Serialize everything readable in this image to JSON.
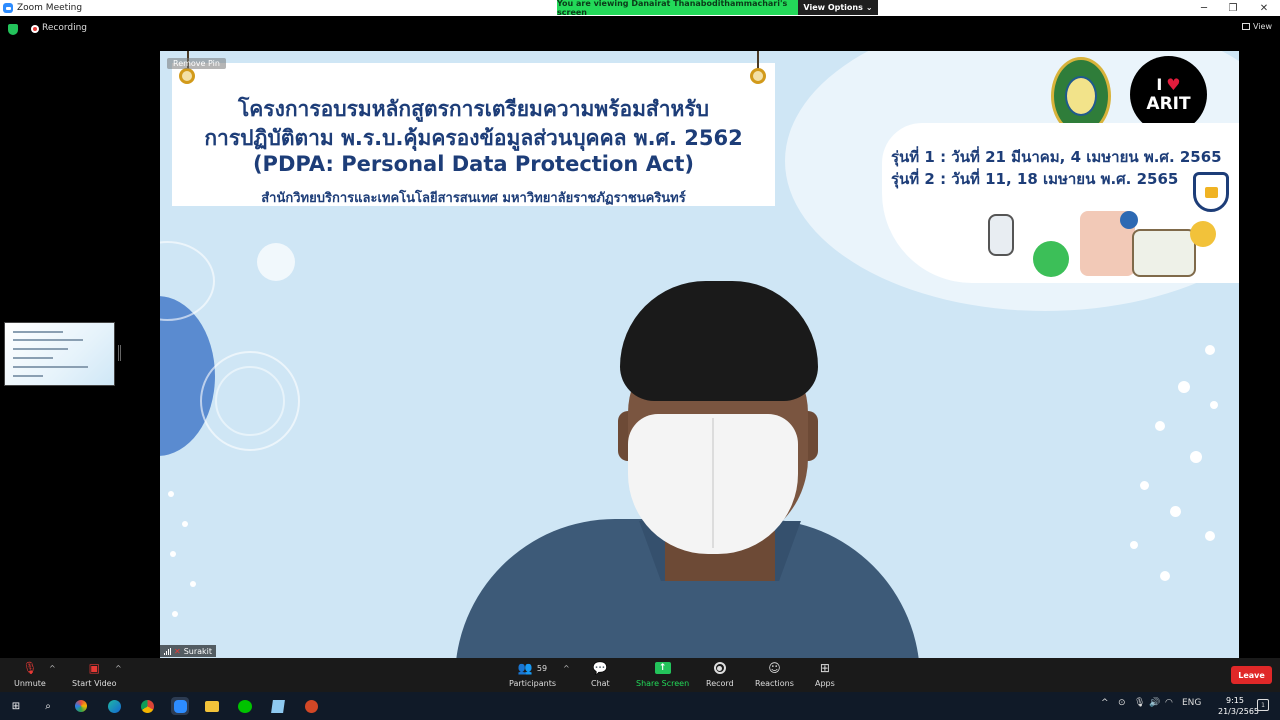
{
  "window": {
    "title": "Zoom Meeting",
    "viewing_banner": "You are viewing Danairat Thanabodithammachari's screen",
    "view_options": "View Options",
    "view_options_caret": "⌄",
    "min": "─",
    "restore": "❐",
    "close": "✕"
  },
  "status": {
    "recording": "Recording",
    "view": "View"
  },
  "slide": {
    "pin_label": "Remove Pin",
    "title_line1": "โครงการอบรมหลักสูตรการเตรียมความพร้อมสำหรับ",
    "title_line2": "การปฏิบัติตาม พ.ร.บ.คุ้มครองข้อมูลส่วนบุคคล พ.ศ. 2562",
    "title_line3": "(PDPA: Personal Data Protection Act)",
    "subtitle": "สำนักวิทยบริการและเทคโนโลยีสารสนเทศ มหาวิทยาลัยราชภัฏราชนครินทร์",
    "logo_arit_i": "I",
    "logo_arit_heart": "♥",
    "logo_arit_name": "ARIT",
    "batch1": "รุ่นที่ 1 : วันที่ 21 มีนาคม, 4 เมษายน พ.ศ. 2565",
    "batch2": "รุ่นที่ 2 : วันที่ 11, 18 เมษายน พ.ศ. 2565"
  },
  "participant": {
    "name": "Surakit"
  },
  "toolbar": {
    "unmute": "Unmute",
    "start_video": "Start Video",
    "participants": "Participants",
    "participants_count": "59",
    "chat": "Chat",
    "share_screen": "Share Screen",
    "share_arrow": "↑",
    "record": "Record",
    "reactions": "Reactions",
    "apps": "Apps",
    "leave": "Leave",
    "caret": "^"
  },
  "taskbar": {
    "windows": "⊞",
    "search": "⌕",
    "lang": "ENG",
    "time": "9:15",
    "date": "21/3/2565",
    "chevron": "^",
    "notif_count": "1"
  },
  "icons": {
    "mic_off": "🎙",
    "video_off": "▣",
    "participants": "👥",
    "chat": "💬",
    "reactions": "☺",
    "apps": "⊞"
  },
  "colors": {
    "share_green": "#23d959",
    "leave_red": "#e02828",
    "slide_blue": "#1d3d78"
  }
}
